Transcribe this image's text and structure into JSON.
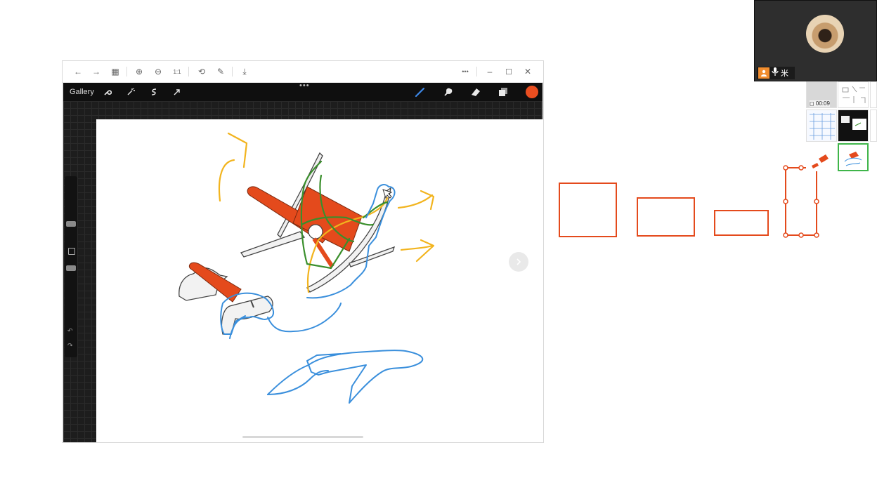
{
  "viewer": {
    "toolbar": {
      "back_icon": "←",
      "forward_icon": "→",
      "grid_icon": "▦",
      "zoom_in_icon": "⊕",
      "zoom_out_icon": "⊖",
      "actual_size_icon": "1:1",
      "rotate_icon": "⟲",
      "edit_icon": "✎",
      "save_icon": "⤓",
      "more_icon": "•••",
      "minimize_icon": "–",
      "maximize_icon": "☐",
      "close_icon": "✕"
    }
  },
  "procreate": {
    "gallery_label": "Gallery",
    "drag_handle": "•••",
    "color_accent": "#ea4e20",
    "tools": [
      "wrench-icon",
      "magic-wand-icon",
      "selection-icon",
      "transform-icon",
      "brush-icon",
      "smudge-icon",
      "eraser-icon",
      "layers-icon"
    ]
  },
  "drawing_colors": {
    "blue": "#3a8fdc",
    "green": "#3a8f2c",
    "yellow": "#f2b41e",
    "red": "#e44a1c"
  },
  "video_call": {
    "status_icons": [
      "user-icon",
      "mic-icon",
      "spotlight-icon"
    ],
    "thumbnail_time": "00:09"
  }
}
